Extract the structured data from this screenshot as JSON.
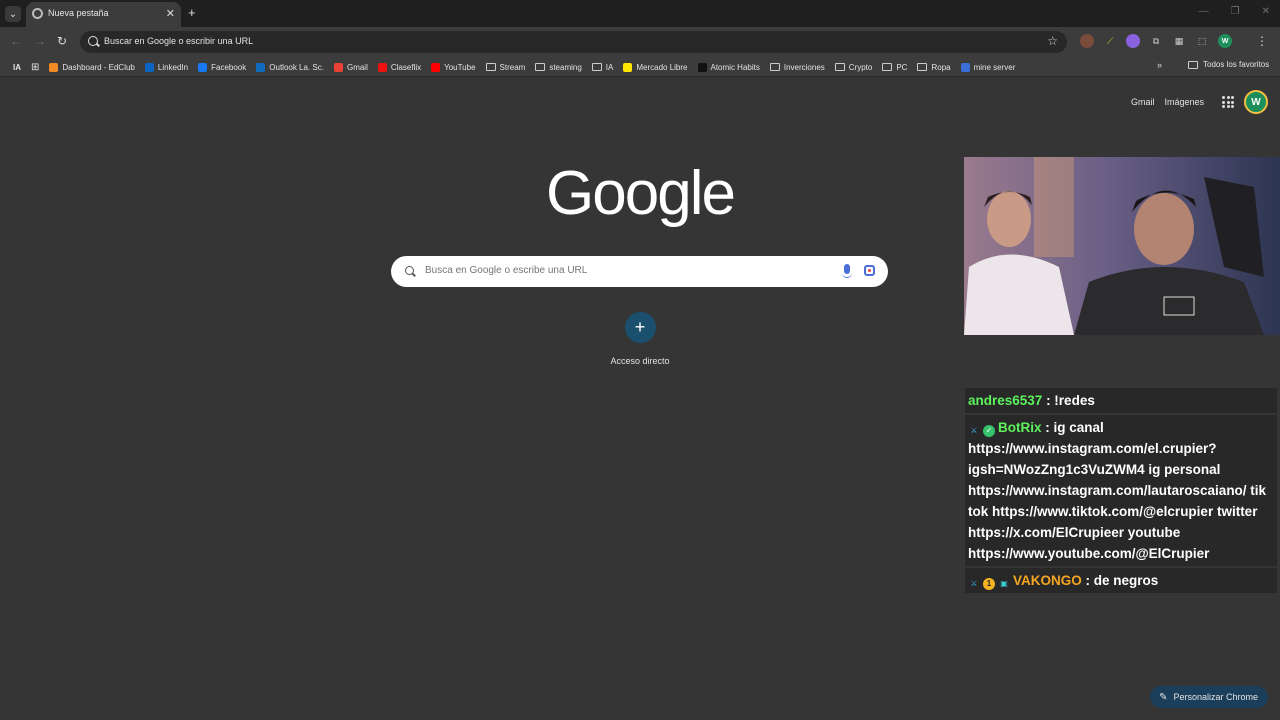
{
  "tab": {
    "title": "Nueva pestaña"
  },
  "omnibox": {
    "text": "Buscar en Google o escribir una URL"
  },
  "bookmarks": [
    {
      "label": "IA",
      "type": "text"
    },
    {
      "label": "",
      "type": "apps"
    },
    {
      "label": "Dashboard - EdClub",
      "type": "site",
      "color": "#f28b25"
    },
    {
      "label": "LinkedIn",
      "type": "site",
      "color": "#0a66c2"
    },
    {
      "label": "Facebook",
      "type": "site",
      "color": "#1877f2"
    },
    {
      "label": "Outlook La. Sc.",
      "type": "site",
      "color": "#0f6cbd"
    },
    {
      "label": "Gmail",
      "type": "site",
      "color": "#ea4335"
    },
    {
      "label": "Claseflix",
      "type": "site",
      "color": "#e11"
    },
    {
      "label": "YouTube",
      "type": "site",
      "color": "#ff0000"
    },
    {
      "label": "Stream",
      "type": "folder"
    },
    {
      "label": "steaming",
      "type": "folder"
    },
    {
      "label": "IA",
      "type": "folder"
    },
    {
      "label": "Mercado Libre",
      "type": "site",
      "color": "#ffe600"
    },
    {
      "label": "Atomic Habits",
      "type": "site",
      "color": "#111111"
    },
    {
      "label": "Inverciones",
      "type": "folder"
    },
    {
      "label": "Crypto",
      "type": "folder"
    },
    {
      "label": "PC",
      "type": "folder"
    },
    {
      "label": "Ropa",
      "type": "folder"
    },
    {
      "label": "mine server",
      "type": "site",
      "color": "#3b6fd8"
    }
  ],
  "all_bookmarks": "Todos los favoritos",
  "ntp": {
    "gmail": "Gmail",
    "images": "Imágenes",
    "avatar": "W",
    "logo": "Google",
    "search_placeholder": "Busca en Google o escribe una URL",
    "shortcut_label": "Acceso directo",
    "shortcut_icon": "+",
    "customize": "Personalizar Chrome"
  },
  "chat": [
    {
      "user": "andres6537",
      "user_color": "#5cf25c",
      "text": " : !redes",
      "badges": []
    },
    {
      "user": "BotRix",
      "user_color": "#5cf25c",
      "text": " : ig canal https://www.instagram.com/el.crupier?igsh=NWozZng1c3VuZWM4 ig personal https://www.instagram.com/lautaroscaiano/ tik tok https://www.tiktok.com/@elcrupier twitter https://x.com/ElCrupieer youtube https://www.youtube.com/@ElCrupier",
      "badges": [
        "sword",
        "verified"
      ]
    },
    {
      "user": "VAKONGO",
      "user_color": "#f5a623",
      "text": " : de negros",
      "badges": [
        "sword",
        "coin",
        "qr"
      ]
    }
  ]
}
